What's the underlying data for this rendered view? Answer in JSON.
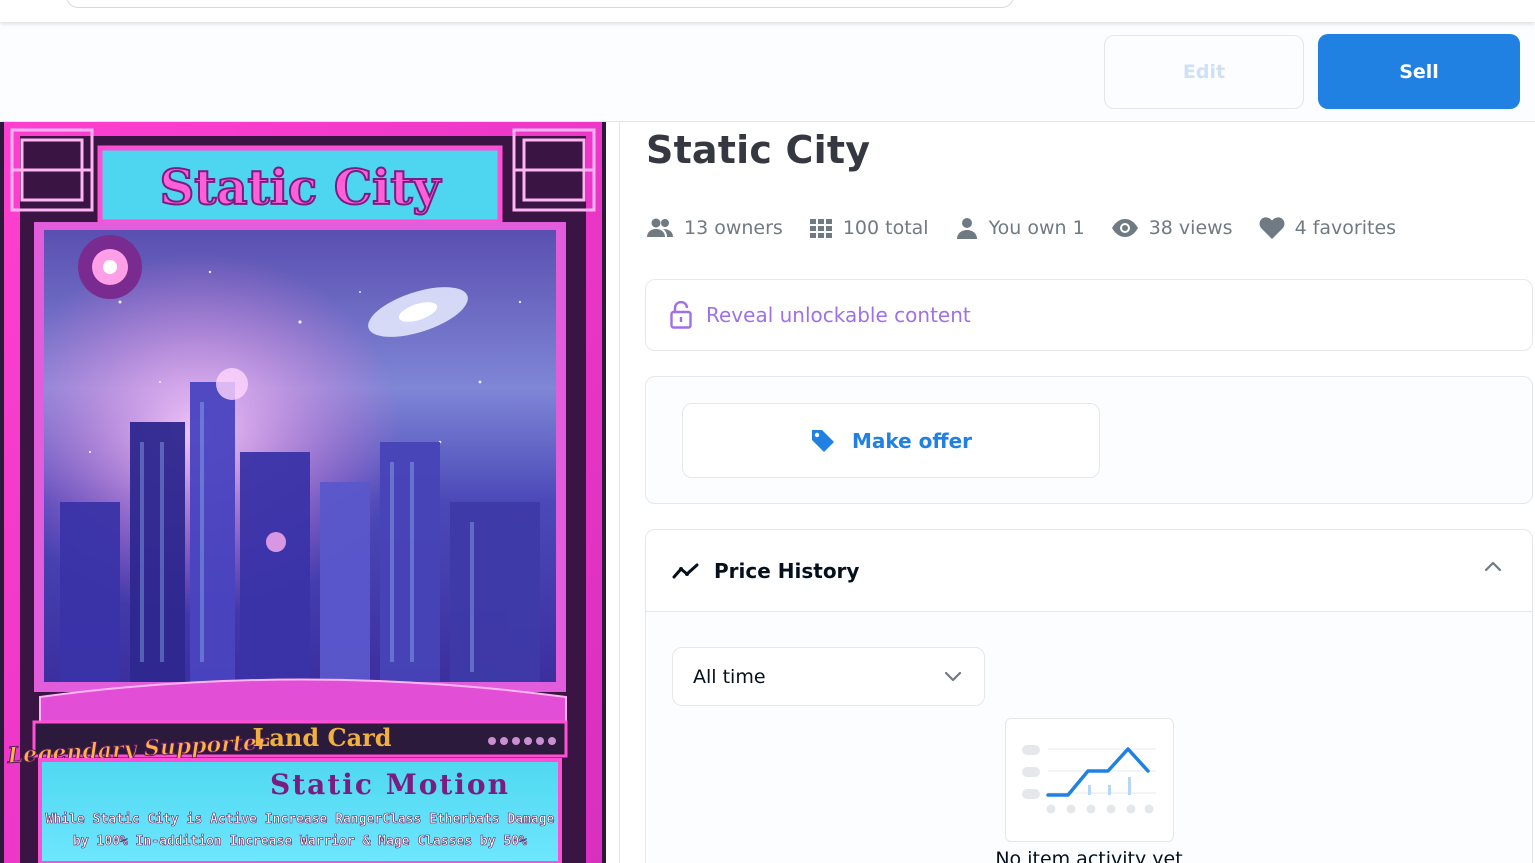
{
  "header": {
    "edit_label": "Edit",
    "sell_label": "Sell"
  },
  "card": {
    "title_art": "Static City",
    "rarity": "Legendary Supporter",
    "type": "Land Card",
    "ability_name": "Static Motion",
    "ability_text_1": "While Static City is Active Increase RangerClass Etherbats Damage",
    "ability_text_2": "by 100% In-addition Increase Warrior & Mage Classes by 50%"
  },
  "item": {
    "title": "Static City",
    "stats": {
      "owners": "13 owners",
      "total": "100 total",
      "own": "You own 1",
      "views": "38 views",
      "favorites": "4 favorites"
    },
    "reveal_label": "Reveal unlockable content",
    "offer_label": "Make offer"
  },
  "price_history": {
    "title": "Price History",
    "range_selected": "All time",
    "empty_text": "No item activity yet"
  },
  "colors": {
    "accent": "#2081e2",
    "unlockable": "#9e71e8",
    "text_muted": "#707a83",
    "text_dark": "#353840"
  }
}
